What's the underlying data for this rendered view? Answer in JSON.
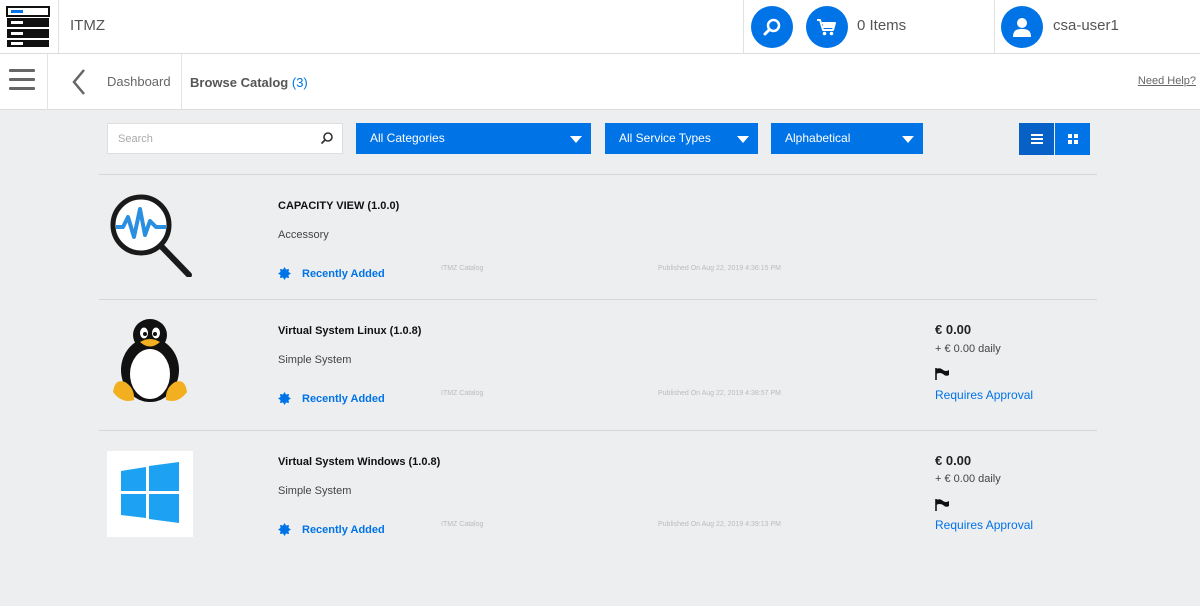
{
  "header": {
    "app_title": "ITMZ",
    "cart_label": "0 Items",
    "user_name": "csa-user1"
  },
  "subbar": {
    "breadcrumb_parent": "Dashboard",
    "breadcrumb_current": "Browse Catalog",
    "catalog_count": "(3)",
    "help_link": "Need Help?"
  },
  "filters": {
    "search_placeholder": "Search",
    "category": "All Categories",
    "service_type": "All Service Types",
    "sort": "Alphabetical"
  },
  "items": [
    {
      "name": "CAPACITY VIEW (1.0.0)",
      "subtype": "Accessory",
      "badge": "Recently Added",
      "catalog": "ITMZ Catalog",
      "published": "Published On Aug 22, 2019 4:36:15 PM",
      "icon": "capacity-view-magnifier-icon"
    },
    {
      "name": "Virtual System Linux (1.0.8)",
      "subtype": "Simple System",
      "badge": "Recently Added",
      "catalog": "ITMZ Catalog",
      "published": "Published On Aug 22, 2019 4:38:57 PM",
      "price": "€ 0.00",
      "daily": "+ € 0.00 daily",
      "approval": "Requires Approval",
      "icon": "linux-tux-icon"
    },
    {
      "name": "Virtual System Windows (1.0.8)",
      "subtype": "Simple System",
      "badge": "Recently Added",
      "catalog": "ITMZ Catalog",
      "published": "Published On Aug 22, 2019 4:39:13 PM",
      "price": "€ 0.00",
      "daily": "+ € 0.00 daily",
      "approval": "Requires Approval",
      "icon": "windows-logo-icon"
    }
  ],
  "colors": {
    "accent": "#0073e7",
    "background": "#edeef0"
  }
}
